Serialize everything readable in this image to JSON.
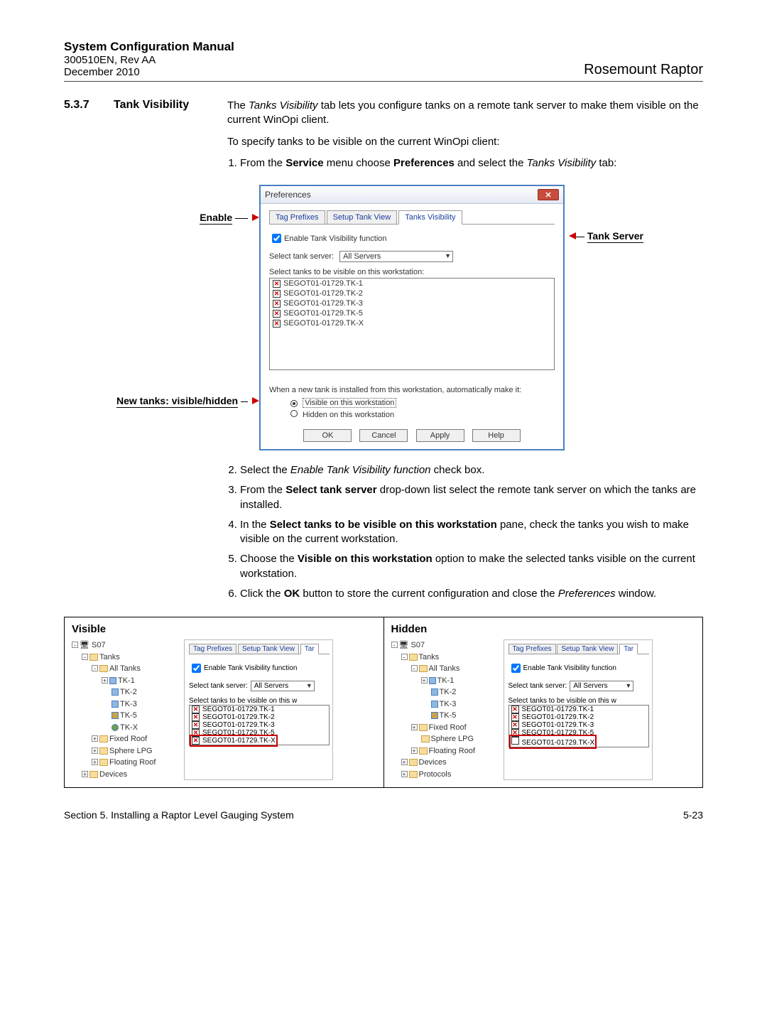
{
  "header": {
    "title": "System Configuration Manual",
    "code": "300510EN, Rev AA",
    "date": "December 2010",
    "product": "Rosemount Raptor"
  },
  "section": {
    "number": "5.3.7",
    "title": "Tank Visibility",
    "intro1a": "The ",
    "intro1b": "Tanks Visibility",
    "intro1c": " tab lets you configure tanks on a remote tank server to make them visible on the current WinOpi client.",
    "intro2": "To specify tanks to be visible on the current WinOpi client:",
    "step1a": "From the ",
    "step1b": "Service",
    "step1c": " menu choose ",
    "step1d": "Preferences",
    "step1e": " and select the ",
    "step1f": "Tanks Visibility",
    "step1g": " tab:"
  },
  "callouts": {
    "enable": "Enable",
    "newtanks": "New tanks: visible/hidden",
    "tankserver": "Tank Server"
  },
  "dlg": {
    "title": "Preferences",
    "tab1": "Tag Prefixes",
    "tab2": "Setup Tank View",
    "tab3": "Tanks Visibility",
    "enable": "Enable Tank Visibility function",
    "selectserver": "Select tank server:",
    "server_val": "All Servers",
    "selecttanks": "Select tanks to be visible on this workstation:",
    "t1": "SEGOT01-01729.TK-1",
    "t2": "SEGOT01-01729.TK-2",
    "t3": "SEGOT01-01729.TK-3",
    "t5": "SEGOT01-01729.TK-5",
    "tx": "SEGOT01-01729.TK-X",
    "newtank": "When a new tank is installed from this workstation, automatically make it:",
    "visible": "Visible on this workstation",
    "hidden": "Hidden on this workstation",
    "ok": "OK",
    "cancel": "Cancel",
    "apply": "Apply",
    "help": "Help"
  },
  "steps2": {
    "s2a": "Select the ",
    "s2b": "Enable Tank Visibility function",
    "s2c": " check box.",
    "s3a": "From the ",
    "s3b": "Select tank server",
    "s3c": " drop-down list select the remote tank server on which the tanks are installed.",
    "s4a": "In the ",
    "s4b": "Select tanks to be visible on this workstation",
    "s4c": " pane, check the tanks you wish to make visible on the current workstation.",
    "s5a": "Choose the ",
    "s5b": "Visible on this workstation",
    "s5c": " option to make the selected tanks visible on the current workstation.",
    "s6a": "Click the ",
    "s6b": "OK",
    "s6c": " button to store the current configuration and close the ",
    "s6d": "Preferences",
    "s6e": " window."
  },
  "comp": {
    "visible": "Visible",
    "hidden": "Hidden"
  },
  "tree": {
    "root": "S07",
    "tanks": "Tanks",
    "all": "All Tanks",
    "tk1": "TK-1",
    "tk2": "TK-2",
    "tk3": "TK-3",
    "tk5": "TK-5",
    "tkx": "TK-X",
    "fixed": "Fixed Roof",
    "sphere": "Sphere LPG",
    "floating": "Floating Roof",
    "devices": "Devices",
    "protocols": "Protocols"
  },
  "mini": {
    "tabs1": "Tag Prefixes",
    "tabs2": "Setup Tank View",
    "tabs3": "Tar",
    "enable": "Enable Tank Visibility function",
    "selectserver": "Select tank server:",
    "server_val": "All Servers",
    "selecttanks": "Select tanks to be visible on this w"
  },
  "footer": {
    "left": "Section 5. Installing a Raptor Level Gauging System",
    "right": "5-23"
  }
}
